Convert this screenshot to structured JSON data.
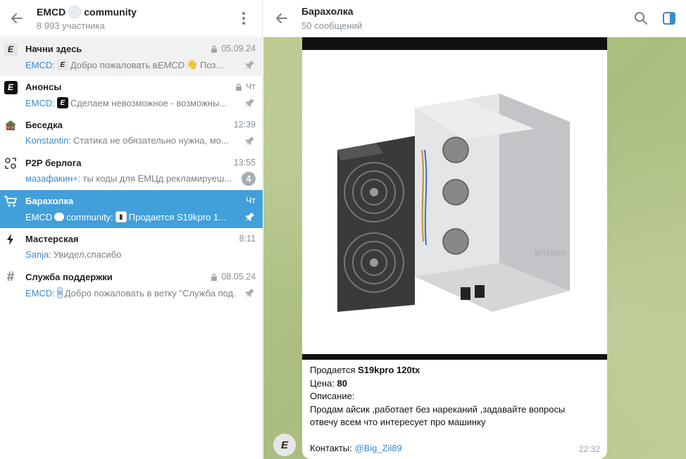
{
  "left_header": {
    "title_pre": "EMCD",
    "title_post": "community",
    "subtitle": "8 993 участника"
  },
  "topics": [
    {
      "name": "Начни здесь",
      "date": "05.09.24",
      "sender": "EMCD:",
      "text_pre": "Добро пожаловать в ",
      "text_em": "EMCD",
      "text_post": " Поз...",
      "locked": true,
      "pinned": true
    },
    {
      "name": "Анонсы",
      "date": "Чт",
      "sender": "EMCD:",
      "text_pre": "Сделаем невозможное - возможны...",
      "locked": true,
      "pinned": true
    },
    {
      "name": "Беседка",
      "date": "12:39",
      "sender": "Konstantin:",
      "text_pre": "Статика не обязательно нужна, мо...",
      "pinned": true
    },
    {
      "name": "P2P берлога",
      "date": "13:55",
      "sender": "мазафакин+:",
      "text_pre": "ты коды для ЕМЦд рекламируеш...",
      "count": "4"
    },
    {
      "name": "Барахолка",
      "date": "Чт",
      "sender": "EMCD",
      "sender2": "community:",
      "text_pre": "Продается S19kpro 1...",
      "pinned": true
    },
    {
      "name": "Мастерская",
      "date": "8:11",
      "sender": "Sanja:",
      "text_pre": "Увидел,спасибо"
    },
    {
      "name": "Служба поддержки",
      "date": "08.05.24",
      "sender": "EMCD:",
      "text_pre": "Добро пожаловать в ветку \"Служба под...",
      "locked": true,
      "pinned": true
    }
  ],
  "chat_header": {
    "title": "Барахолка",
    "subtitle": "50 сообщений"
  },
  "message": {
    "line1_pre": "Продается ",
    "line1_bold": "S19kpro 120tx",
    "line2_pre": "Цена: ",
    "line2_bold": "80",
    "line3": "Описание:",
    "line4": "Продам айсик ,работает без нареканий ,задавайте вопросы",
    "line5": "отвечу всем что интересует про машинку",
    "contacts_label": "Контакты: ",
    "contacts_link": "@Big_Zil89",
    "time": "22:32",
    "image_brand": "BITMAIN"
  },
  "colors": {
    "accent": "#419fd9",
    "chat_bg": "#b7c78e"
  }
}
